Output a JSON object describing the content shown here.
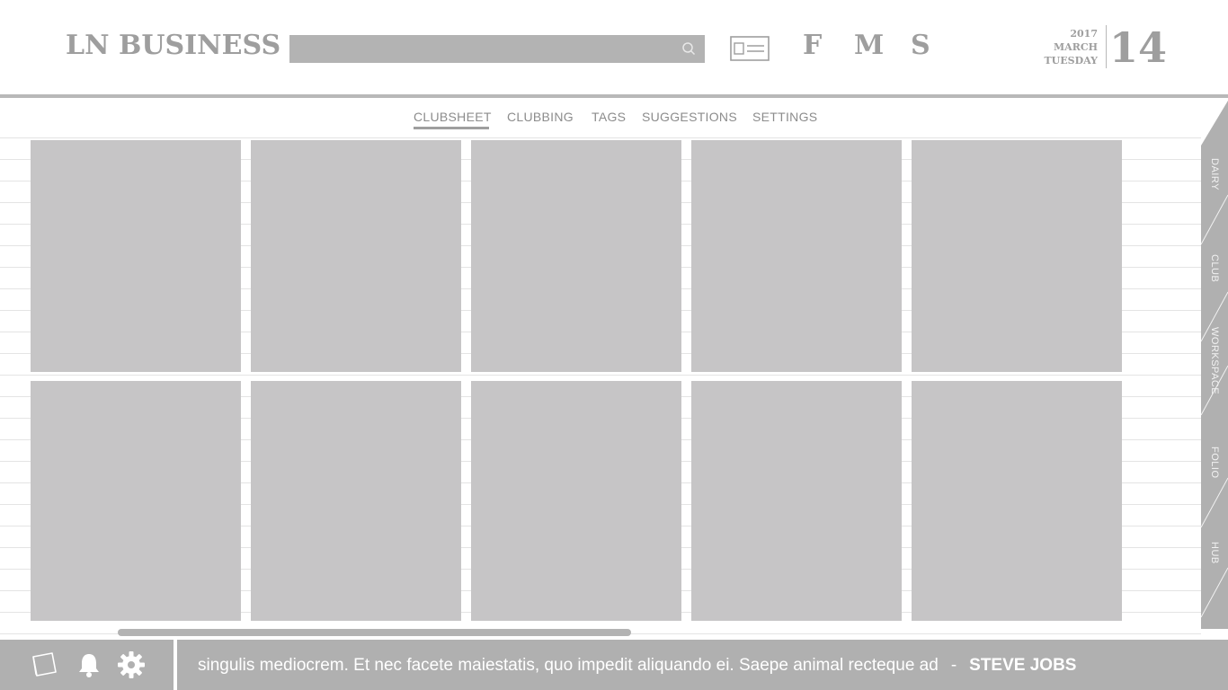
{
  "header": {
    "logo": "LN BUSINESS",
    "search": {
      "placeholder": ""
    },
    "quick_links": [
      "F",
      "M",
      "S"
    ],
    "date": {
      "year": "2017",
      "month": "MARCH",
      "weekday": "TUESDAY",
      "day": "14"
    }
  },
  "nav": {
    "items": [
      "CLUBSHEET",
      "CLUBBING",
      "TAGS",
      "SUGGESTIONS",
      "SETTINGS"
    ],
    "active": "CLUBSHEET"
  },
  "side_tabs": [
    "DAIRY",
    "CLUB",
    "WORKSPACE",
    "FOLIO",
    "HUB"
  ],
  "footer": {
    "quote": "singulis mediocrem. Et nec facete maiestatis, quo impedit aliquando ei. Saepe animal recteque ad",
    "separator": "-",
    "author": "STEVE JOBS"
  },
  "colors": {
    "tile": "#c6c5c6",
    "footer": "#b0b0b0",
    "text_gray": "#9e9e9e"
  },
  "icons": [
    "search-icon",
    "id-card-icon",
    "notes-icon",
    "bell-icon",
    "gear-icon"
  ]
}
